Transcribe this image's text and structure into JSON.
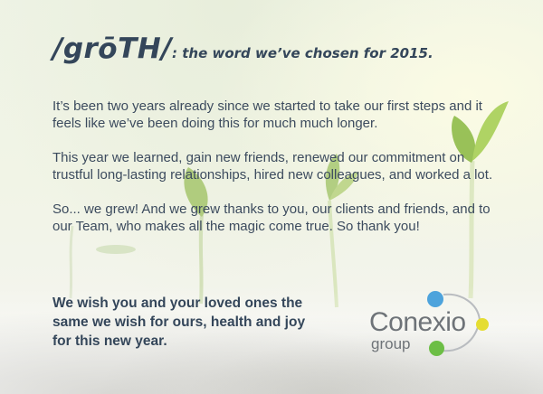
{
  "heading": {
    "big": "/grōTH/",
    "small": ": the word we’ve chosen for 2015."
  },
  "paragraphs": [
    "It’s been two years already since we started to take our first steps and it feels like we’ve been doing this for much much longer.",
    "This year we learned, gain new friends, renewed our commitment on trustful long-lasting relationships, hired new colleagues, and worked a lot.",
    "So... we grew! And we grew thanks to you, our clients and friends, and to our Team, who makes all the magic come true. So thank you!"
  ],
  "wish": "We wish you and your loved ones the same we wish for ours, health and joy for this new year.",
  "logo": {
    "name": "Conexio",
    "sub": "group"
  },
  "colors": {
    "text": "#3a4a5c",
    "logo_blue": "#4da3dc",
    "logo_yellow": "#e5dd32",
    "logo_green": "#6cbe45",
    "logo_gray": "#6e7378"
  }
}
